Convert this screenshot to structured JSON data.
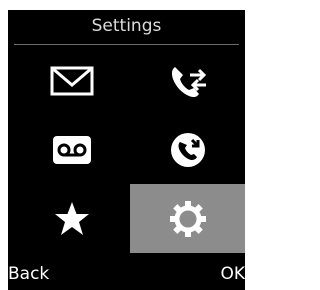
{
  "screen": {
    "title": "Settings"
  },
  "menu": {
    "items": [
      {
        "icon": "envelope-icon",
        "meaning": "messages"
      },
      {
        "icon": "call-transfer-icon",
        "meaning": "calls"
      },
      {
        "icon": "voicemail-icon",
        "meaning": "voicemail"
      },
      {
        "icon": "call-diversion-icon",
        "meaning": "call redirect"
      },
      {
        "icon": "star-icon",
        "meaning": "favorites"
      },
      {
        "icon": "gear-icon",
        "meaning": "settings",
        "selected": true
      }
    ]
  },
  "softkeys": {
    "left": "Back",
    "right": "OK"
  },
  "colors": {
    "background": "#000000",
    "selection": "#8c8c8c",
    "text": "#ffffff"
  }
}
